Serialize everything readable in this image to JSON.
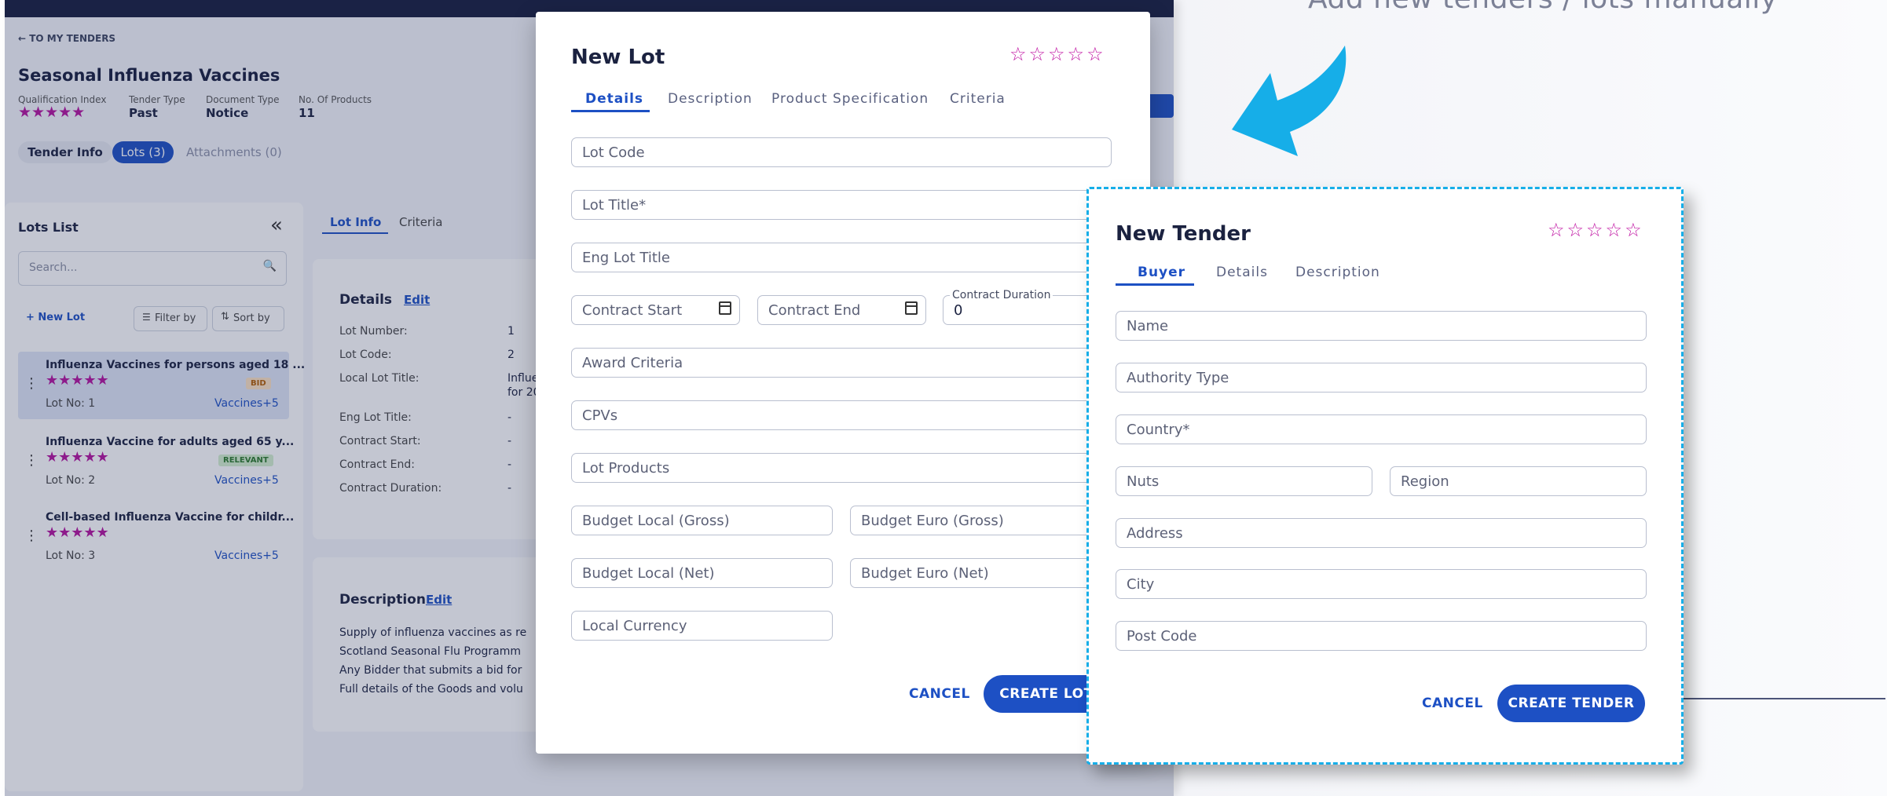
{
  "caption": "Add new tenders / lots  manually",
  "app": {
    "back_link": "TO MY TENDERS",
    "title": "Seasonal Influenza Vaccines",
    "meta": [
      {
        "label": "Qualification Index",
        "value": "★★★★★"
      },
      {
        "label": "Tender Type",
        "value": "Past"
      },
      {
        "label": "Document Type",
        "value": "Notice"
      },
      {
        "label": "No. Of Products",
        "value": "11"
      }
    ],
    "tabs": [
      "Tender Info",
      "Lots (3)",
      "Attachments (0)"
    ],
    "lots_list": {
      "heading": "Lots List",
      "collapse_icon": "double-chevron-left-icon",
      "search_placeholder": "Search...",
      "new_lot": "+ New Lot",
      "filter": "Filter by",
      "sort": "Sort by",
      "items": [
        {
          "title": "Influenza Vaccines for persons aged 18 ...",
          "stars": "★★★★★",
          "badge": "BID",
          "lot_no": "Lot No: 1",
          "link": "Vaccines+5"
        },
        {
          "title": "Influenza Vaccine for adults aged 65 y...",
          "stars": "★★★★★",
          "badge": "RELEVANT",
          "lot_no": "Lot No: 2",
          "link": "Vaccines+5"
        },
        {
          "title": "Cell-based Influenza Vaccine for childr...",
          "stars": "★★★★★",
          "badge": "",
          "lot_no": "Lot No: 3",
          "link": "Vaccines+5"
        }
      ]
    },
    "detail_tabs": [
      "Lot Info",
      "Criteria"
    ],
    "details": {
      "heading": "Details",
      "edit": "Edit",
      "rows": [
        {
          "label": "Lot Number:",
          "value": "1"
        },
        {
          "label": "Lot Code:",
          "value": "2"
        },
        {
          "label": "Local Lot Title:",
          "value": "Influe"
        },
        {
          "label": "",
          "value": "for 20"
        },
        {
          "label": "Eng Lot Title:",
          "value": "-"
        },
        {
          "label": "Contract Start:",
          "value": "-"
        },
        {
          "label": "Contract End:",
          "value": "-"
        },
        {
          "label": "Contract Duration:",
          "value": "-"
        }
      ]
    },
    "description": {
      "heading": "Description",
      "edit": "Edit",
      "lines": [
        "Supply of influenza vaccines as re",
        "Scotland Seasonal Flu Programm",
        "Any Bidder that submits a bid for",
        "Full details of the Goods and volu"
      ]
    }
  },
  "new_lot": {
    "title": "New Lot",
    "stars": "☆☆☆☆☆",
    "tabs": [
      "Details",
      "Description",
      "Product Specification",
      "Criteria"
    ],
    "fields": {
      "lot_code": "Lot Code",
      "lot_title": "Lot Title*",
      "eng_lot_title": "Eng Lot Title",
      "contract_start": "Contract Start",
      "contract_end": "Contract End",
      "contract_duration_label": "Contract Duration",
      "contract_duration_value": "0",
      "award_criteria": "Award Criteria",
      "cpvs": "CPVs",
      "lot_products": "Lot Products",
      "budget_local_gross": "Budget Local (Gross)",
      "budget_euro_gross": "Budget Euro (Gross)",
      "budget_local_net": "Budget Local (Net)",
      "budget_euro_net": "Budget Euro (Net)",
      "local_currency": "Local Currency"
    },
    "cancel": "CANCEL",
    "create": "CREATE LOT"
  },
  "new_tender": {
    "title": "New Tender",
    "stars": "☆☆☆☆☆",
    "tabs": [
      "Buyer",
      "Details",
      "Description"
    ],
    "fields": {
      "name": "Name",
      "authority_type": "Authority Type",
      "country": "Country*",
      "nuts": "Nuts",
      "region": "Region",
      "address": "Address",
      "city": "City",
      "post_code": "Post Code"
    },
    "cancel": "CANCEL",
    "create": "CREATE TENDER"
  },
  "colors": {
    "accent": "#1d50c4",
    "star": "#c21aa5",
    "callout": "#16aee8",
    "navy": "#151c3d"
  }
}
